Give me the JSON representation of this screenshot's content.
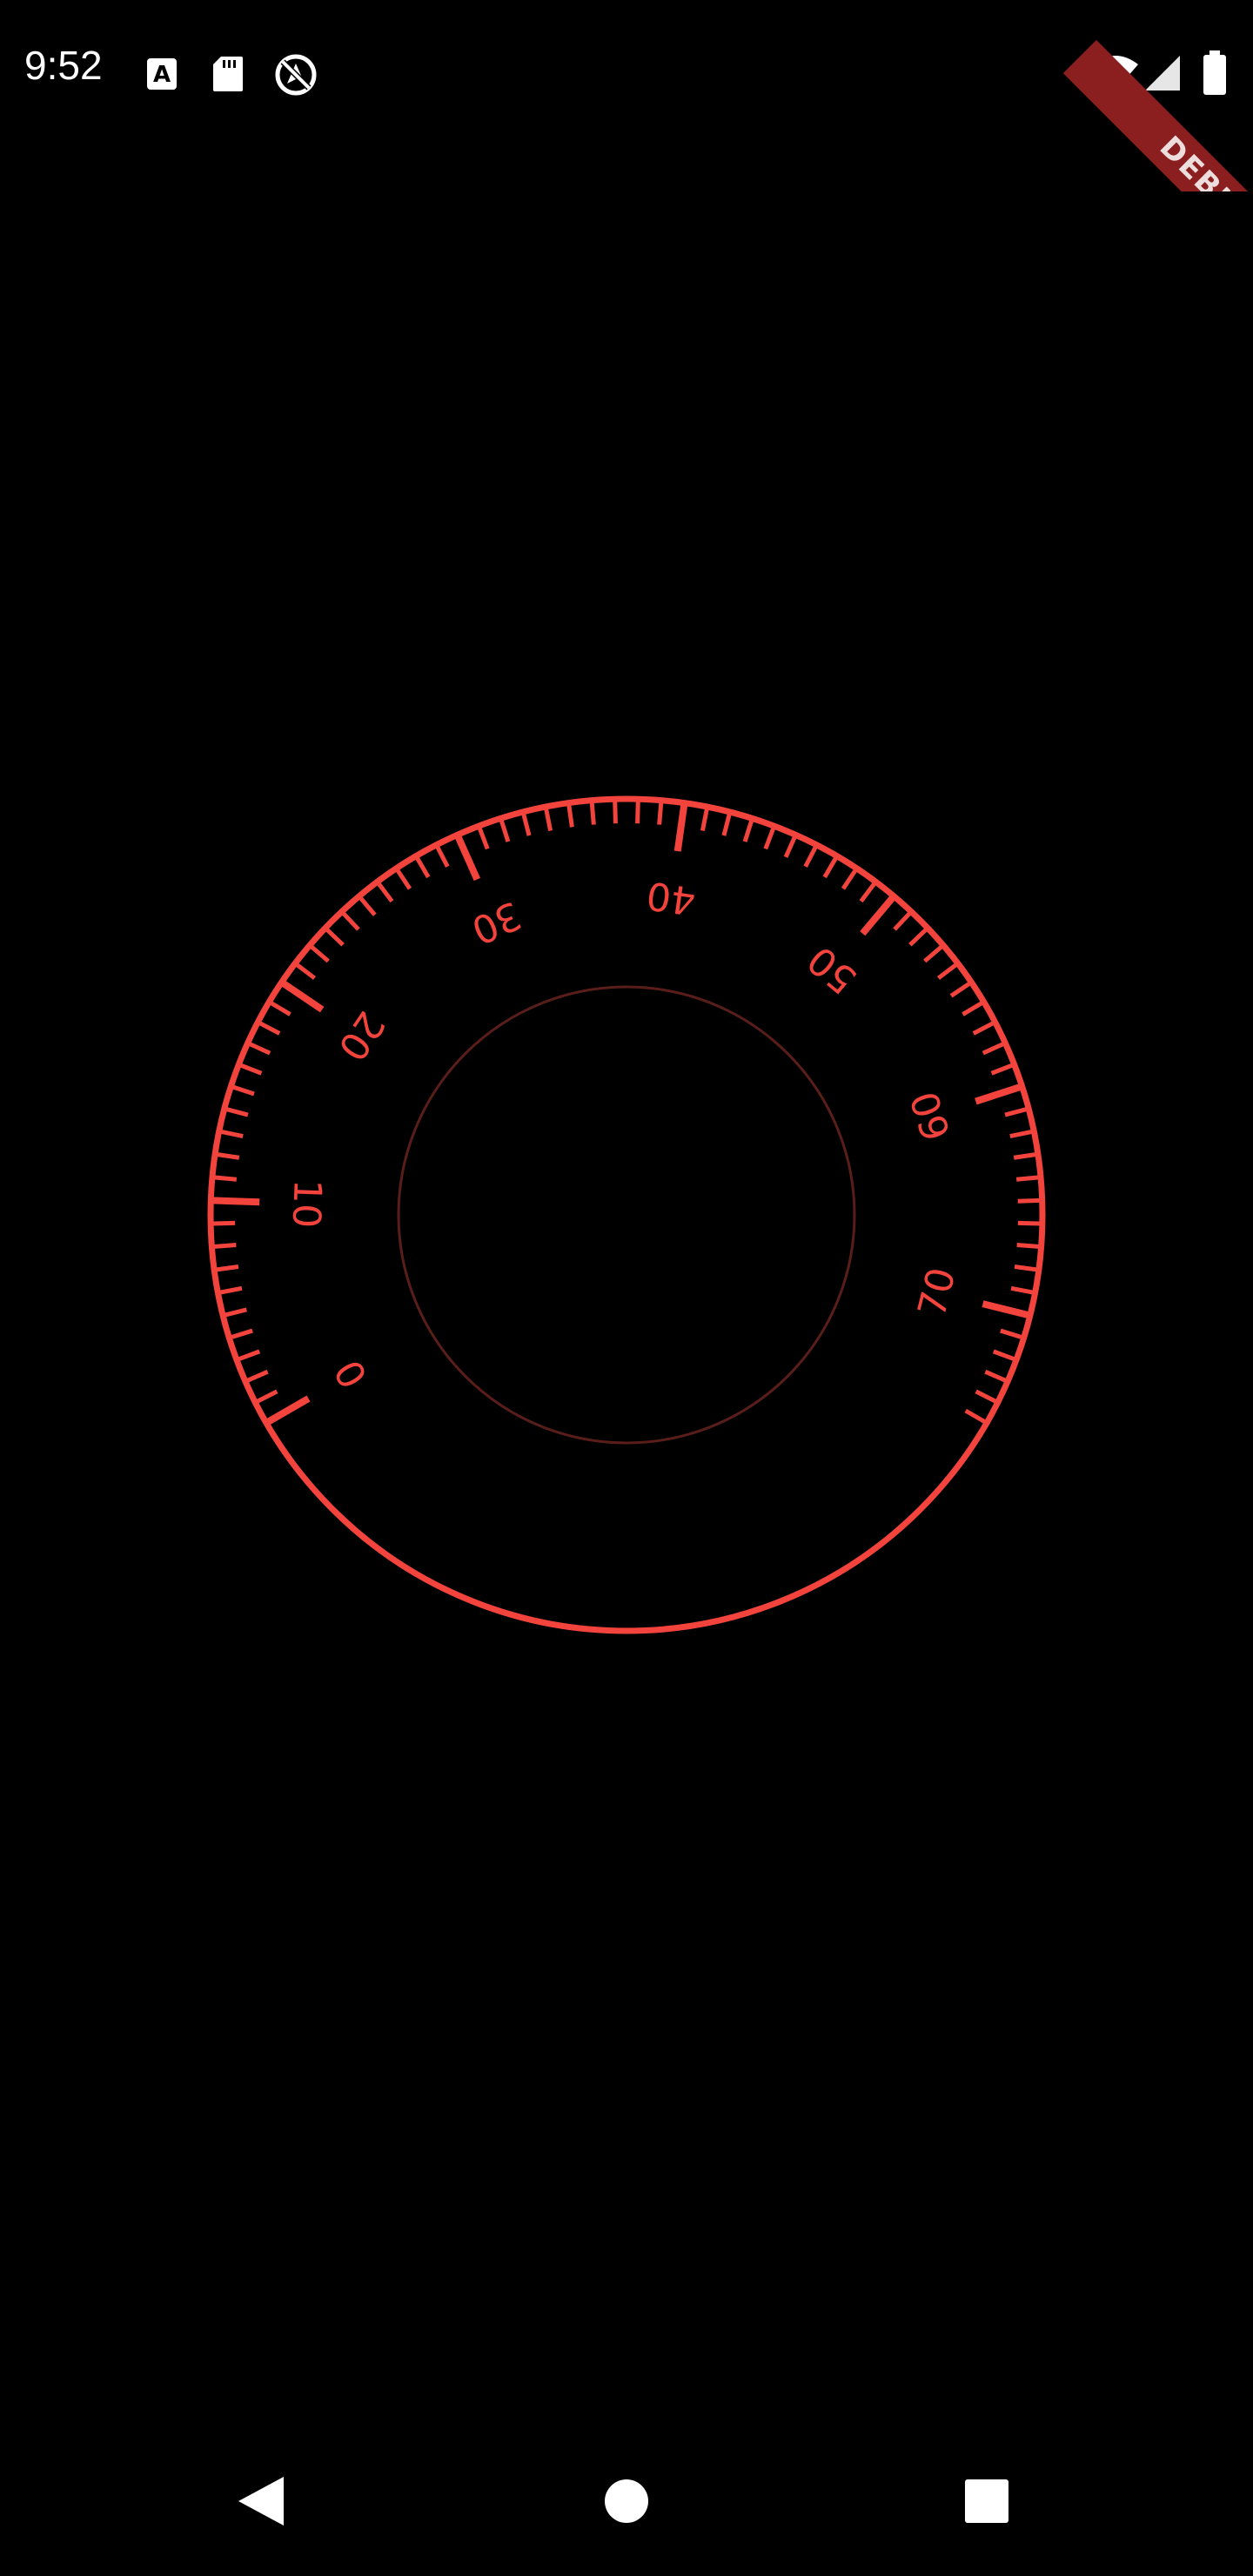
{
  "status_bar": {
    "time": "9:52",
    "left_icons": [
      "text-a-icon",
      "sd-card-icon",
      "no-location-icon"
    ],
    "right_icons": [
      "wifi-icon",
      "cell-signal-icon",
      "battery-icon"
    ]
  },
  "debug_banner": {
    "label": "DEBUG"
  },
  "dial": {
    "labels": [
      "0",
      "10",
      "20",
      "30",
      "40",
      "50",
      "60",
      "70"
    ],
    "min": 0,
    "max": 75,
    "major_step": 10,
    "minor_step": 1,
    "color": "#f2433d",
    "inner_ring_color": "#5a1e1a"
  },
  "nav_bar": {
    "icons": [
      "back-icon",
      "home-icon",
      "recents-icon"
    ]
  },
  "colors": {
    "background": "#000000",
    "foreground": "#ffffff",
    "accent": "#f2433d"
  }
}
